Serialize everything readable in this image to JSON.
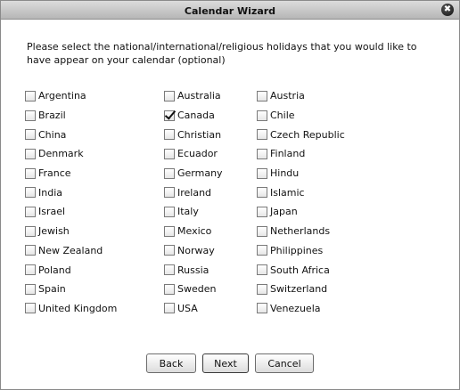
{
  "window": {
    "title": "Calendar Wizard",
    "close_glyph": "✖"
  },
  "instructions": "Please select the national/international/religious holidays that you would like to have appear on your calendar (optional)",
  "columns": [
    [
      {
        "label": "Argentina",
        "checked": false
      },
      {
        "label": "Brazil",
        "checked": false
      },
      {
        "label": "China",
        "checked": false
      },
      {
        "label": "Denmark",
        "checked": false
      },
      {
        "label": "France",
        "checked": false
      },
      {
        "label": "India",
        "checked": false
      },
      {
        "label": "Israel",
        "checked": false
      },
      {
        "label": "Jewish",
        "checked": false
      },
      {
        "label": "New Zealand",
        "checked": false
      },
      {
        "label": "Poland",
        "checked": false
      },
      {
        "label": "Spain",
        "checked": false
      },
      {
        "label": "United Kingdom",
        "checked": false
      }
    ],
    [
      {
        "label": "Australia",
        "checked": false
      },
      {
        "label": "Canada",
        "checked": true
      },
      {
        "label": "Christian",
        "checked": false
      },
      {
        "label": "Ecuador",
        "checked": false
      },
      {
        "label": "Germany",
        "checked": false
      },
      {
        "label": "Ireland",
        "checked": false
      },
      {
        "label": "Italy",
        "checked": false
      },
      {
        "label": "Mexico",
        "checked": false
      },
      {
        "label": "Norway",
        "checked": false
      },
      {
        "label": "Russia",
        "checked": false
      },
      {
        "label": "Sweden",
        "checked": false
      },
      {
        "label": "USA",
        "checked": false
      }
    ],
    [
      {
        "label": "Austria",
        "checked": false
      },
      {
        "label": "Chile",
        "checked": false
      },
      {
        "label": "Czech Republic",
        "checked": false
      },
      {
        "label": "Finland",
        "checked": false
      },
      {
        "label": "Hindu",
        "checked": false
      },
      {
        "label": "Islamic",
        "checked": false
      },
      {
        "label": "Japan",
        "checked": false
      },
      {
        "label": "Netherlands",
        "checked": false
      },
      {
        "label": "Philippines",
        "checked": false
      },
      {
        "label": "South Africa",
        "checked": false
      },
      {
        "label": "Switzerland",
        "checked": false
      },
      {
        "label": "Venezuela",
        "checked": false
      }
    ]
  ],
  "buttons": {
    "back": "Back",
    "next": "Next",
    "cancel": "Cancel"
  }
}
